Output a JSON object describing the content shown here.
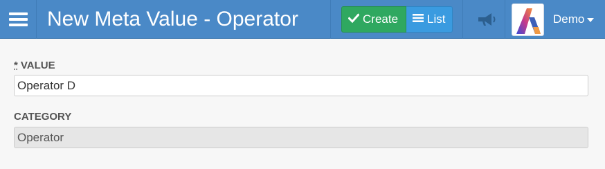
{
  "header": {
    "title": "New Meta Value - Operator",
    "menu_icon": "hamburger-icon",
    "create_label": "Create",
    "create_icon": "check-icon",
    "list_label": "List",
    "list_icon": "list-icon",
    "announce_icon": "megaphone-icon",
    "user_name": "Demo",
    "colors": {
      "bar": "#4a89c7",
      "create": "#2fa860",
      "list": "#3a9be0"
    }
  },
  "form": {
    "value": {
      "required_marker": "*",
      "label": "VALUE",
      "value": "Operator D"
    },
    "category": {
      "label": "CATEGORY",
      "value": "Operator"
    }
  }
}
